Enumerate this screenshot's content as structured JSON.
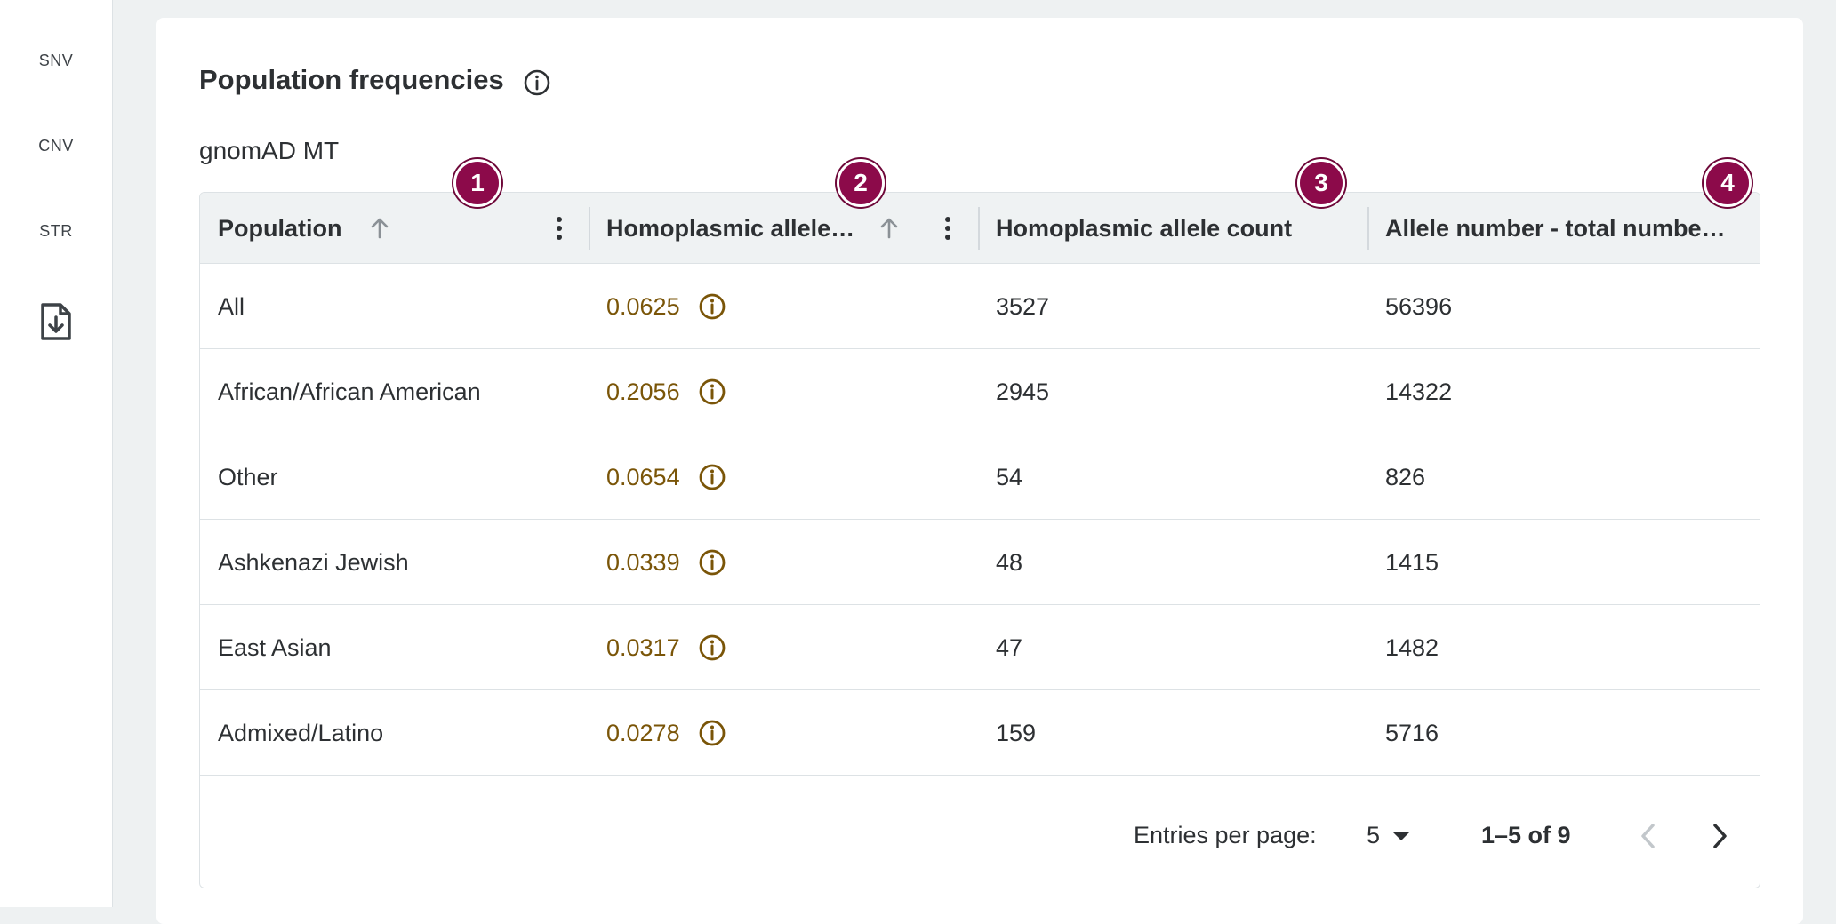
{
  "sidebar": {
    "items": [
      {
        "label": "SNV"
      },
      {
        "label": "CNV"
      },
      {
        "label": "STR"
      }
    ],
    "download_icon": "file-download-icon"
  },
  "card": {
    "title": "Population frequencies",
    "subtitle": "gnomAD MT"
  },
  "table": {
    "columns": [
      {
        "label": "Population"
      },
      {
        "label": "Homoplasmic allele…"
      },
      {
        "label": "Homoplasmic allele count"
      },
      {
        "label": "Allele number - total numbe…"
      }
    ],
    "rows": [
      {
        "population": "All",
        "frequency": "0.0625",
        "count": "3527",
        "allele_number": "56396"
      },
      {
        "population": "African/African American",
        "frequency": "0.2056",
        "count": "2945",
        "allele_number": "14322"
      },
      {
        "population": "Other",
        "frequency": "0.0654",
        "count": "54",
        "allele_number": "826"
      },
      {
        "population": "Ashkenazi Jewish",
        "frequency": "0.0339",
        "count": "48",
        "allele_number": "1415"
      },
      {
        "population": "East Asian",
        "frequency": "0.0317",
        "count": "47",
        "allele_number": "1482"
      },
      {
        "population": "Admixed/Latino",
        "frequency": "0.0278",
        "count": "159",
        "allele_number": "5716"
      }
    ],
    "footer": {
      "entries_label": "Entries per page:",
      "entries_value": "5",
      "range": "1–5 of 9"
    }
  },
  "badges": [
    "1",
    "2",
    "3",
    "4"
  ],
  "colors": {
    "badge": "#8c0a4a",
    "frequency_text": "#7a5508",
    "header_bg": "#eff2f3",
    "page_bg": "#eef1f2"
  }
}
